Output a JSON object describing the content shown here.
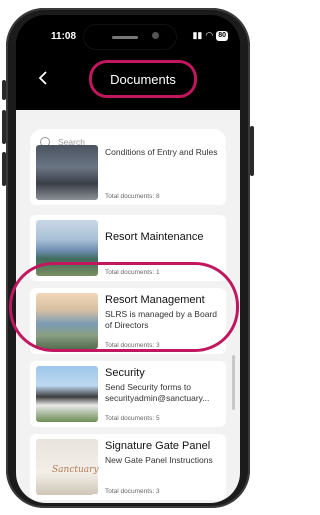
{
  "status": {
    "time": "11:08",
    "battery": "80"
  },
  "header": {
    "title": "Documents"
  },
  "search": {
    "placeholder": "Search"
  },
  "documents": [
    {
      "title": "",
      "desc": "Conditions of Entry and Rules",
      "count": "Total documents: 8",
      "image": "gym-photo"
    },
    {
      "title": "Resort Maintenance",
      "desc": "",
      "count": "Total documents: 1",
      "image": "lake-aerial-photo"
    },
    {
      "title": "Resort Management",
      "desc": "SLRS is managed by a Board of Directors",
      "count": "Total documents: 3",
      "image": "resort-aerial-photo"
    },
    {
      "title": "Security",
      "desc": "Send Security forms to securityadmin@sanctuary...",
      "count": "Total documents: 5",
      "image": "house-photo"
    },
    {
      "title": "Signature Gate Panel",
      "desc": "New Gate Panel Instructions",
      "count": "Total documents: 3",
      "image": "gate-sign-photo"
    }
  ],
  "accent": "#c0175f"
}
